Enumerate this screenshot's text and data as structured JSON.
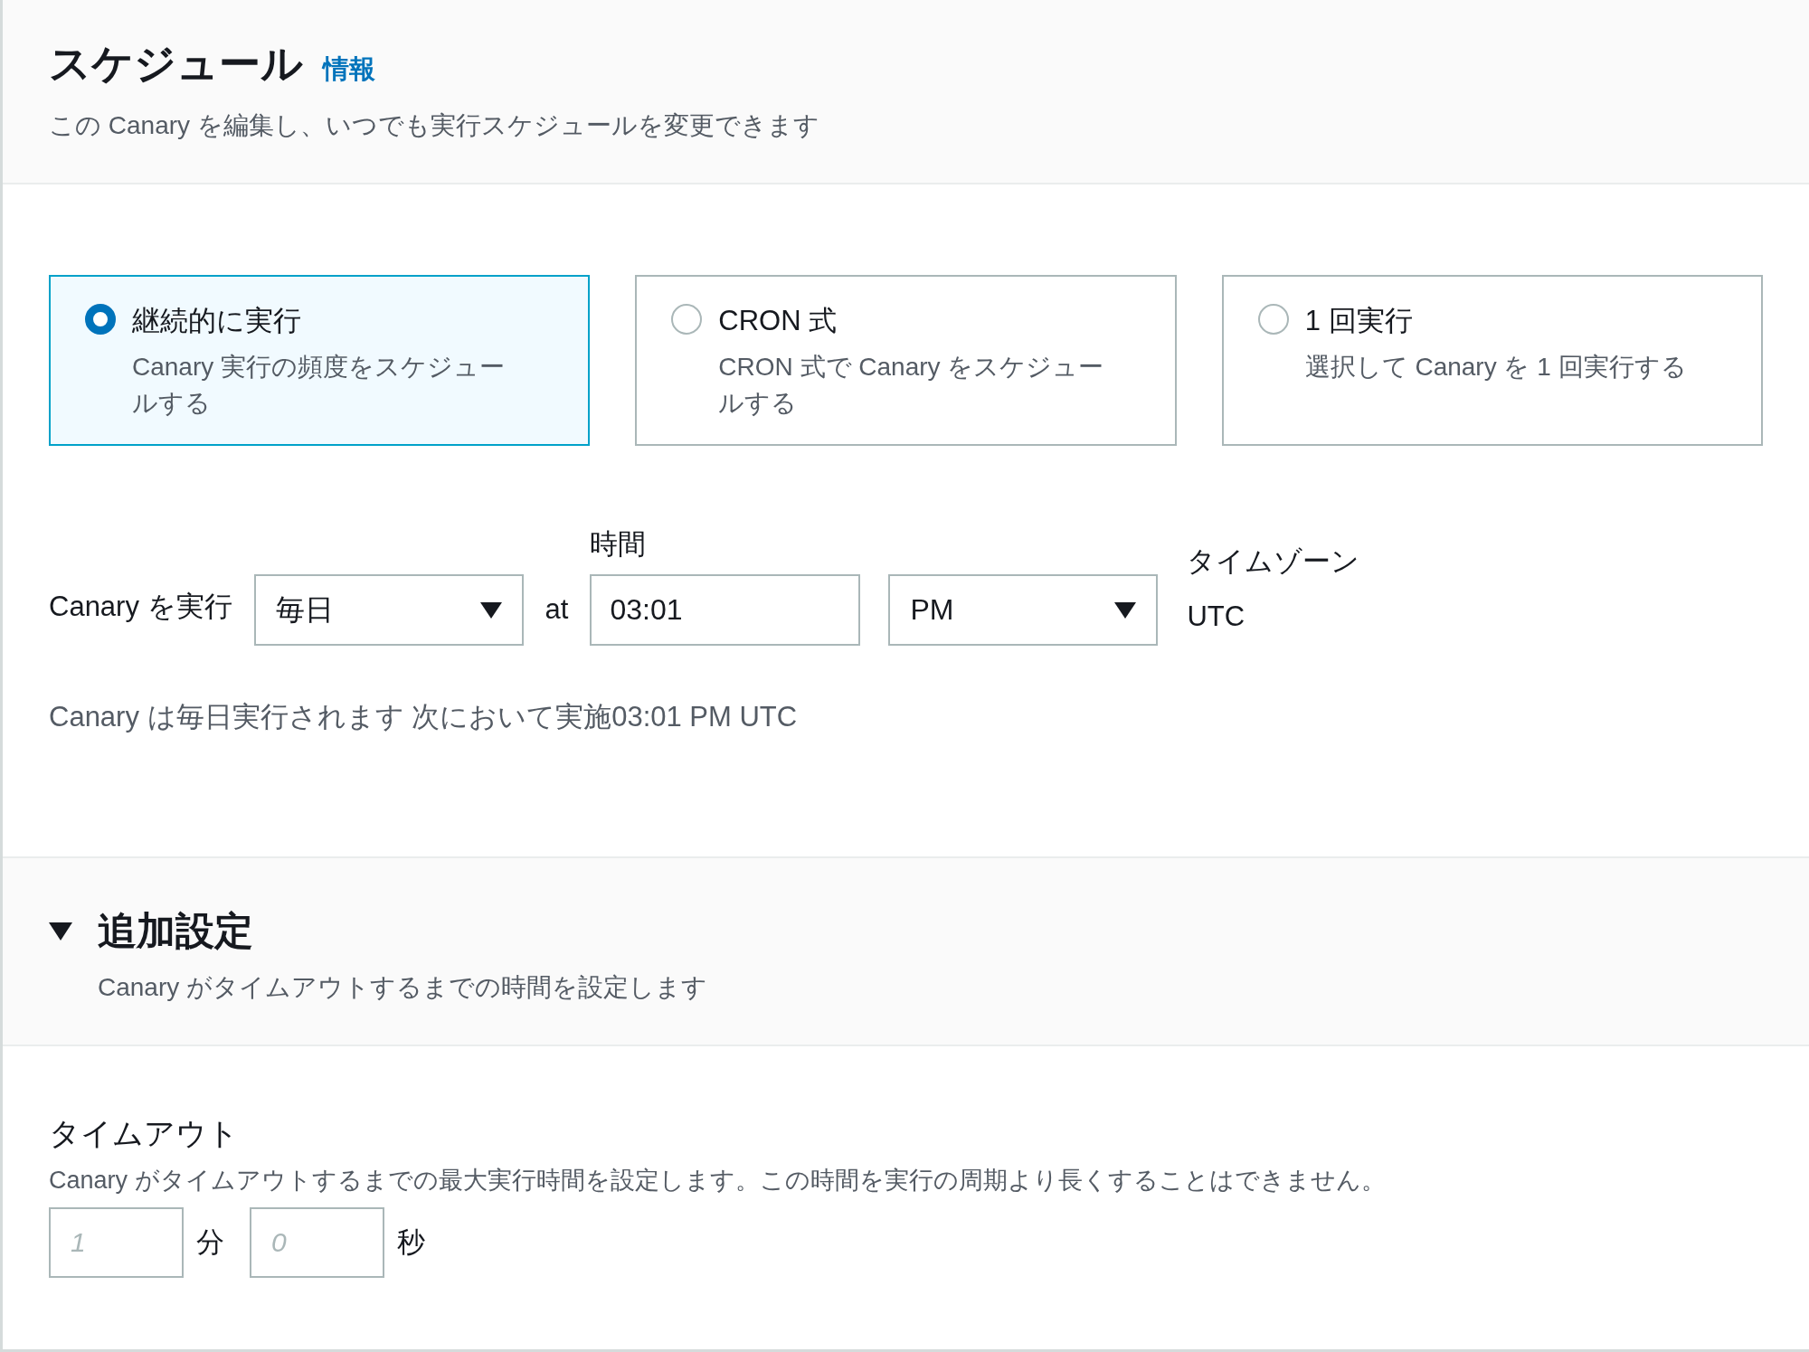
{
  "header": {
    "title": "スケジュール",
    "info_link": "情報",
    "description": "この Canary を編集し、いつでも実行スケジュールを変更できます"
  },
  "schedule_options": [
    {
      "title": "継続的に実行",
      "description": "Canary 実行の頻度をスケジュールする",
      "selected": true
    },
    {
      "title": "CRON 式",
      "description": "CRON 式で Canary をスケジュールする",
      "selected": false
    },
    {
      "title": "1 回実行",
      "description": "選択して Canary を 1 回実行する",
      "selected": false
    }
  ],
  "run_row": {
    "label": "Canary を実行",
    "frequency": "毎日",
    "at": "at",
    "time_label": "時間",
    "time": "03:01",
    "ampm": "PM",
    "timezone_label": "タイムゾーン",
    "timezone": "UTC"
  },
  "summary": "Canary は毎日実行されます 次において実施03:01 PM UTC",
  "additional": {
    "title": "追加設定",
    "expanded": true,
    "description": "Canary がタイムアウトするまでの時間を設定します"
  },
  "timeout": {
    "label": "タイムアウト",
    "description": "Canary がタイムアウトするまでの最大実行時間を設定します。この時間を実行の周期より長くすることはできません。",
    "minutes": {
      "placeholder": "1",
      "unit": "分"
    },
    "seconds": {
      "placeholder": "0",
      "unit": "秒"
    }
  }
}
